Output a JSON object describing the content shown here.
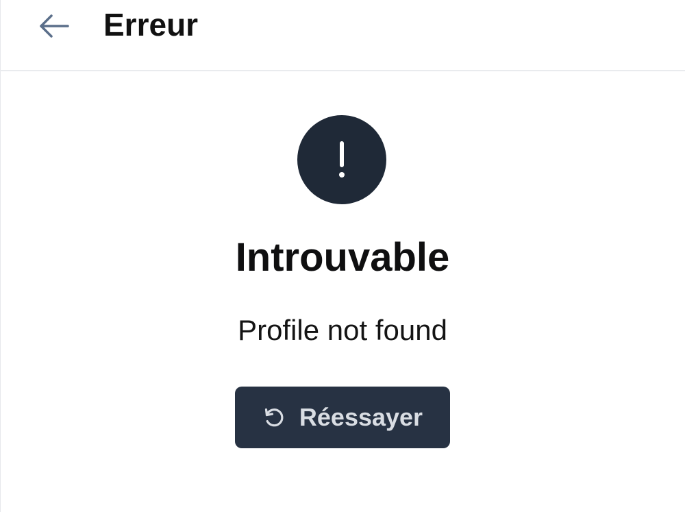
{
  "header": {
    "back_icon": "arrow-left-icon",
    "title": "Erreur"
  },
  "error": {
    "icon": "exclamation-circle-icon",
    "title": "Introuvable",
    "message": "Profile not found"
  },
  "retry_button": {
    "icon": "refresh-icon",
    "label": "Réessayer"
  },
  "colors": {
    "icon_back": "#5b6f8a",
    "dark_accent": "#1f2937",
    "button_bg": "#273243",
    "button_text": "#d9dde3",
    "text_primary": "#111111",
    "divider": "#e9ebee"
  }
}
